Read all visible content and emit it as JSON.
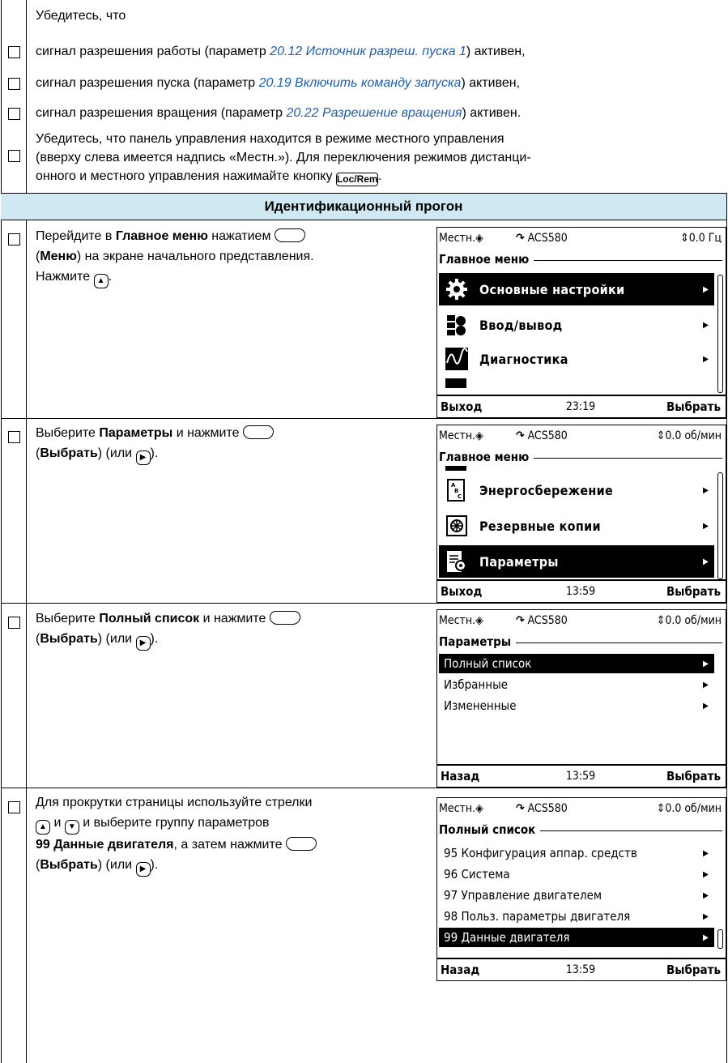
{
  "checklist_top": {
    "intro": "Убедитесь, что",
    "run_enable": {
      "before": "сигнал разрешения работы (параметр ",
      "param": "20.12 Источник разреш. пуска 1",
      "after": ") активен,"
    },
    "start_enable": {
      "before": "сигнал разрешения пуска (параметр ",
      "param": "20.19 Включить команду запуска",
      "after": ") активен,"
    },
    "rotation_enable": {
      "before": "сигнал разрешения вращения (параметр ",
      "param": "20.22 Разрешение вращения",
      "after": ") активен."
    },
    "local_mode": {
      "line1": "Убедитесь, что панель управления находится в режиме местного управления",
      "line2": "(вверху слева имеется надпись «Местн.»). Для переключения режимов дистанци-",
      "line3_before": "онного и местного управления нажимайте кнопку ",
      "key": "Loc/Rem",
      "line3_after": "."
    }
  },
  "section_title": "Идентификационный прогон",
  "steps": [
    {
      "l1_a": "Перейдите в ",
      "l1_b": "Главное меню",
      "l1_c": " нажатием ",
      "l2_a": "(",
      "l2_b": "Меню",
      "l2_c": ") на экране начального представления.",
      "l3": "Нажмите "
    },
    {
      "l1_a": "Выберите ",
      "l1_b": "Параметры",
      "l1_c": " и нажмите ",
      "l2_a": "(",
      "l2_b": "Выбрать",
      "l2_c": ") (или ",
      "l2_d": ")."
    },
    {
      "l1_a": "Выберите ",
      "l1_b": "Полный список",
      "l1_c": " и нажмите ",
      "l2_a": "(",
      "l2_b": "Выбрать",
      "l2_c": ") (или ",
      "l2_d": ")."
    },
    {
      "l1": "Для прокрутки страницы используйте стрелки",
      "l2_b": " и ",
      "l2_c": " и выберите группу параметров",
      "l3_a": "99 Данные двигателя",
      "l3_b": ", а затем нажмите ",
      "l4_a": "(",
      "l4_b": "Выбрать",
      "l4_c": ") (или ",
      "l4_d": ")."
    }
  ],
  "screens": [
    {
      "mode": "Местн.",
      "drive": "ACS580",
      "ref": "0.0 Гц",
      "heading": "Главное меню",
      "items": [
        {
          "label": "Основные настройки",
          "icon": "gear-icon",
          "selected": true
        },
        {
          "label": "Ввод/вывод",
          "icon": "io-icon",
          "selected": false
        },
        {
          "label": "Диагностика",
          "icon": "diagnostics-icon",
          "selected": false
        }
      ],
      "left": "Выход",
      "time": "23:19",
      "right": "Выбрать"
    },
    {
      "mode": "Местн.",
      "drive": "ACS580",
      "ref": "0.0 об/мин",
      "heading": "Главное меню",
      "items": [
        {
          "label": "Энергосбережение",
          "icon": "energy-icon",
          "selected": false
        },
        {
          "label": "Резервные копии",
          "icon": "backup-icon",
          "selected": false
        },
        {
          "label": "Параметры",
          "icon": "parameters-icon",
          "selected": true
        }
      ],
      "left": "Выход",
      "time": "13:59",
      "right": "Выбрать"
    },
    {
      "mode": "Местн.",
      "drive": "ACS580",
      "ref": "0.0 об/мин",
      "heading": "Параметры",
      "items": [
        {
          "label": "Полный список",
          "selected": true
        },
        {
          "label": "Избранные",
          "selected": false
        },
        {
          "label": "Измененные",
          "selected": false
        }
      ],
      "left": "Назад",
      "time": "13:59",
      "right": "Выбрать"
    },
    {
      "mode": "Местн.",
      "drive": "ACS580",
      "ref": "0.0 об/мин",
      "heading": "Полный список",
      "items": [
        {
          "label": "95 Конфигурация аппар. средств",
          "selected": false
        },
        {
          "label": "96 Система",
          "selected": false
        },
        {
          "label": "97 Управление двигателем",
          "selected": false
        },
        {
          "label": "98 Польз. параметры двигателя",
          "selected": false
        },
        {
          "label": "99 Данные двигателя",
          "selected": true
        }
      ],
      "left": "Назад",
      "time": "13:59",
      "right": "Выбрать"
    }
  ]
}
